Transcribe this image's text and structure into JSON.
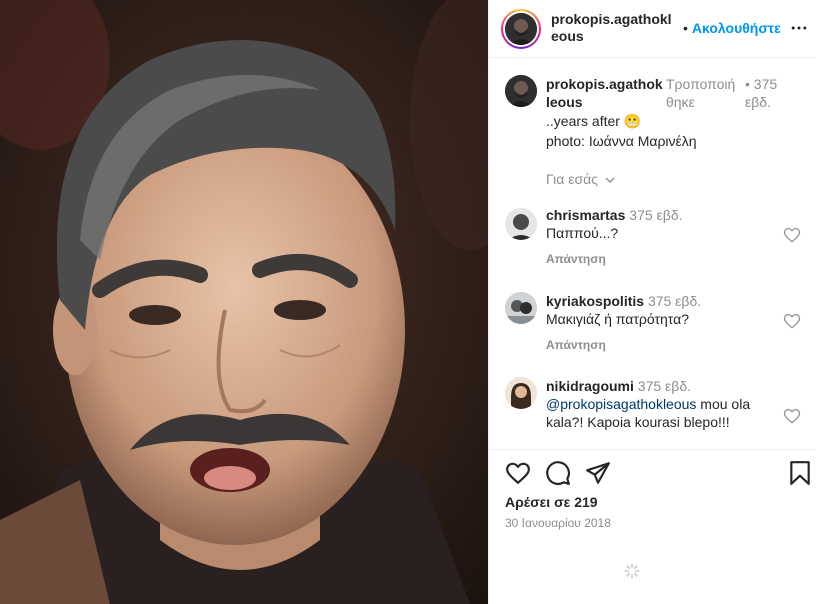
{
  "post": {
    "author": "prokopis.agathokleous",
    "follow_label": "Ακολουθήστε",
    "follow_dot": "•"
  },
  "caption": {
    "username": "prokopis.agathokleous",
    "edited": "Τροποποιή θηκε",
    "time": "• 375 εβδ.",
    "line1": "..years after 😬",
    "line2": "photo: Ιωάννα Μαρινέλη",
    "translate": "Για εσάς"
  },
  "comments": [
    {
      "username": "chrismartas",
      "time": "375 εβδ.",
      "text": "Παππού...?",
      "reply": "Απάντηση"
    },
    {
      "username": "kyriakospolitis",
      "time": "375 εβδ.",
      "text": "Μακιγιάζ ή πατρότητα?",
      "reply": "Απάντηση"
    },
    {
      "username": "nikidragoumi",
      "time": "375 εβδ.",
      "mention": "@prokopisagathokleous",
      "text": " mou ola kala?! Kapoia kourasi blepo!!!"
    }
  ],
  "likes": {
    "prefix": "Αρέσει σε",
    "count": "219"
  },
  "date": "30 Ιανουαρίου 2018",
  "icons": {
    "like": "heart-icon",
    "comment": "comment-icon",
    "share": "paper-plane-icon",
    "save": "bookmark-icon",
    "more": "more-options-icon"
  },
  "colors": {
    "accent": "#0095f6",
    "text": "#262626",
    "muted": "#8e8e8e"
  }
}
